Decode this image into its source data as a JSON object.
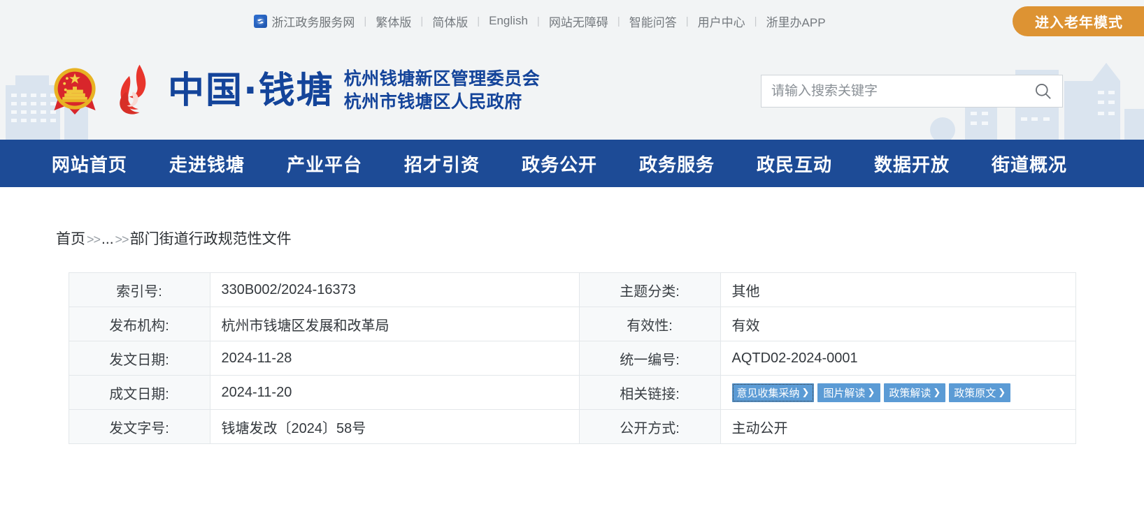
{
  "topbar": {
    "portal_link": "浙江政务服务网",
    "portal_icon": "zhejiang-gov-badge-icon",
    "links": [
      "繁体版",
      "简体版",
      "English",
      "网站无障碍",
      "智能问答",
      "用户中心",
      "浙里办APP"
    ],
    "separator": "|",
    "elder_mode_button": "进入老年模式",
    "accent_color": "#dd9333",
    "bar_background": "#f2f4f5"
  },
  "header": {
    "emblem_icon": "china-national-emblem-icon",
    "flame_icon": "qiantang-flame-logo-icon",
    "brand_main": "中国·钱塘",
    "brand_sub_line1": "杭州钱塘新区管理委员会",
    "brand_sub_line2": "杭州市钱塘区人民政府",
    "brand_color": "#14449a",
    "search": {
      "placeholder": "请输入搜索关键字",
      "value": "",
      "icon": "search-icon"
    }
  },
  "mainnav": {
    "background": "#1d4b96",
    "items": [
      "网站首页",
      "走进钱塘",
      "产业平台",
      "招才引资",
      "政务公开",
      "政务服务",
      "政民互动",
      "数据开放",
      "街道概况"
    ]
  },
  "breadcrumb": {
    "home": "首页",
    "arrow": ">>",
    "ellipsis": "...",
    "current": "部门街道行政规范性文件"
  },
  "info_table": {
    "rows": [
      {
        "left_label": "索引号:",
        "left_value": "330B002/2024-16373",
        "right_label": "主题分类:",
        "right_value": "其他"
      },
      {
        "left_label": "发布机构:",
        "left_value": "杭州市钱塘区发展和改革局",
        "right_label": "有效性:",
        "right_value": "有效"
      },
      {
        "left_label": "发文日期:",
        "left_value": "2024-11-28",
        "right_label": "统一编号:",
        "right_value": "AQTD02-2024-0001"
      },
      {
        "left_label": "成文日期:",
        "left_value": "2024-11-20",
        "right_label": "相关链接:",
        "right_value": ""
      },
      {
        "left_label": "发文字号:",
        "left_value": "钱塘发改〔2024〕58号",
        "right_label": "公开方式:",
        "right_value": "主动公开"
      }
    ],
    "related_links": [
      {
        "label": "意见收集采纳",
        "caret": "❯"
      },
      {
        "label": "图片解读",
        "caret": "❯"
      },
      {
        "label": "政策解读",
        "caret": "❯"
      },
      {
        "label": "政策原文",
        "caret": "❯"
      }
    ],
    "chip_color": "#5b9bd5",
    "label_background": "#f7f9fa"
  }
}
